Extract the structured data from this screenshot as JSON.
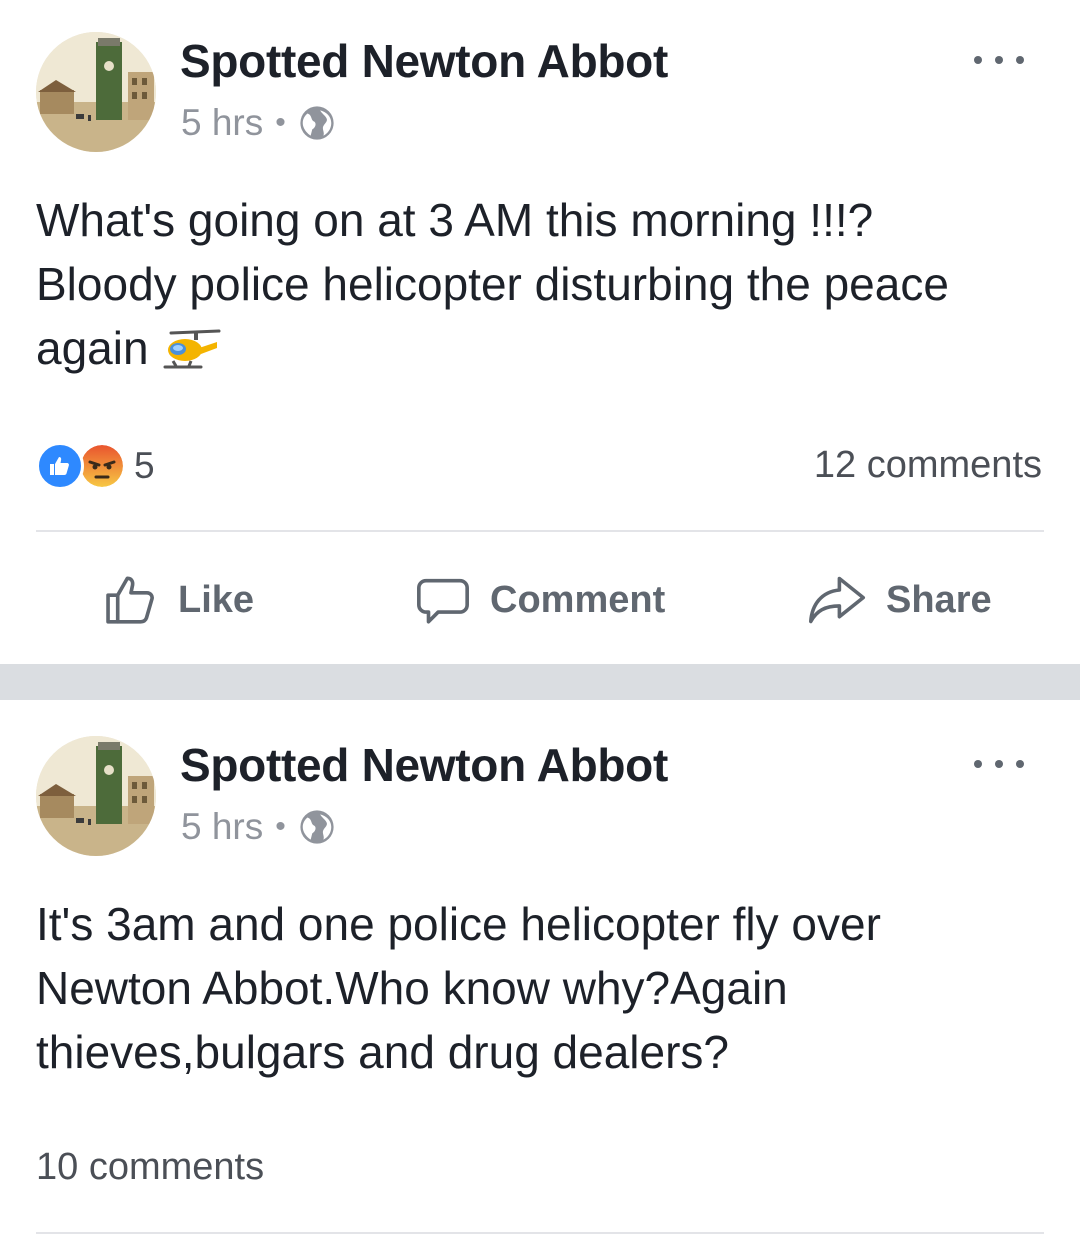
{
  "posts": [
    {
      "page_name": "Spotted Newton Abbot",
      "time": "5 hrs",
      "separator": "•",
      "privacy_icon": "globe-icon",
      "text_lines": [
        "What's going on at 3 AM this morning !!!?",
        "Bloody police helicopter disturbing the peace",
        "again"
      ],
      "emoji": "helicopter-icon",
      "reactions": [
        "like-reaction-icon",
        "angry-reaction-icon"
      ],
      "reaction_count": "5",
      "comments": "12 comments",
      "actions": {
        "like": "Like",
        "comment": "Comment",
        "share": "Share"
      }
    },
    {
      "page_name": "Spotted Newton Abbot",
      "time": "5 hrs",
      "separator": "•",
      "privacy_icon": "globe-icon",
      "text_lines": [
        "It's 3am and one police helicopter fly over",
        "Newton Abbot.Who know why?Again",
        "thieves,bulgars and drug dealers?"
      ],
      "comments": "10 comments"
    }
  ],
  "colors": {
    "accent": "#4267b2",
    "like_blue": "#2e89ff",
    "separator": "#dadde1",
    "meta_gray": "#90949c"
  }
}
